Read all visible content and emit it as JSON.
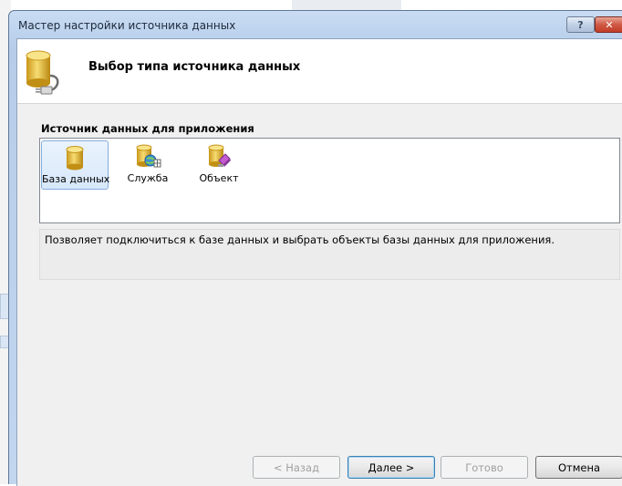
{
  "window": {
    "title": "Мастер настройки источника данных",
    "help_button": "?",
    "close_button": "✕"
  },
  "header": {
    "title": "Выбор типа источника данных",
    "icon": "database-connector-icon"
  },
  "section": {
    "label": "Источник данных для приложения"
  },
  "data_sources": [
    {
      "label": "База данных",
      "icon": "database-icon",
      "selected": true
    },
    {
      "label": "Служба",
      "icon": "service-icon",
      "selected": false
    },
    {
      "label": "Объект",
      "icon": "object-icon",
      "selected": false
    }
  ],
  "description": "Позволяет подключиться к базе данных и выбрать объекты базы данных для приложения.",
  "buttons": {
    "back": "< Назад",
    "next": "Далее >",
    "finish": "Готово",
    "cancel": "Отмена"
  },
  "colors": {
    "selection": "#d7e8fb",
    "database_yellow": "#e8b923",
    "close_red": "#c23c26"
  }
}
